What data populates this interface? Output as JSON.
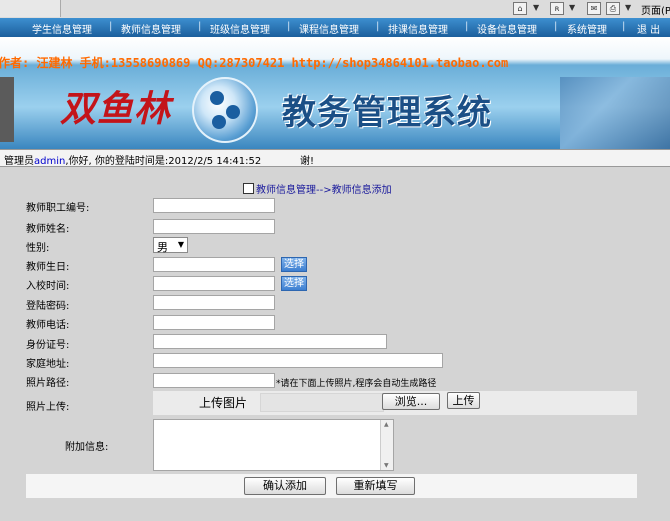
{
  "browser": {
    "page_menu": "页面(P)"
  },
  "nav": {
    "items": [
      "学生信息管理",
      "教师信息管理",
      "班级信息管理",
      "课程信息管理",
      "排课信息管理",
      "设备信息管理",
      "系统管理",
      "退 出"
    ]
  },
  "banner": {
    "author_line": "作者: 汪建林  手机:13558690869 QQ:287307421 http://shop34864101.taobao.com",
    "logo_text": "双鱼林",
    "system_title": "教务管理系统"
  },
  "userbar": {
    "prefix": "管理员",
    "user": "admin",
    "suffix": ",你好, 你的登陆时间是:2012/2/5 14:41:52",
    "tail": "谢!"
  },
  "form": {
    "breadcrumb": "教师信息管理-->教师信息添加",
    "fields": {
      "teacher_no": "教师职工编号:",
      "teacher_name": "教师姓名:",
      "gender": "性别:",
      "birthday": "教师生日:",
      "entry_date": "入校时间:",
      "password": "登陆密码:",
      "phone": "教师电话:",
      "id_card": "身份证号:",
      "address": "家庭地址:",
      "photo_path": "照片路径:",
      "photo_upload": "照片上传:",
      "extra_info": "附加信息:"
    },
    "gender_value": "男",
    "select_label": "选择",
    "path_hint": "*请在下面上传照片,程序会自动生成路径",
    "upload_label": "上传图片",
    "browse_label": "浏览...",
    "upload_button": "上传",
    "submit_button": "确认添加",
    "reset_button": "重新填写"
  }
}
